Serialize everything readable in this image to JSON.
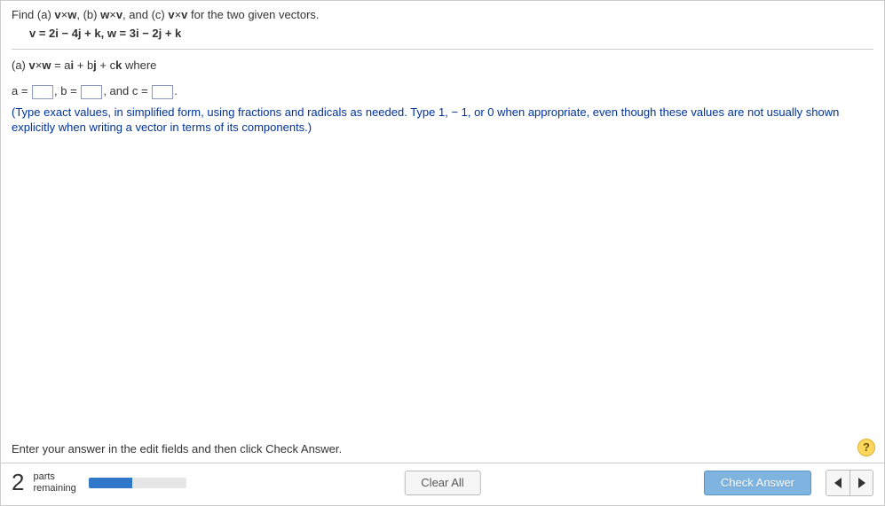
{
  "question": {
    "intro_prefix": "Find (a) ",
    "cross1_left": "v",
    "times": "×",
    "cross1_right": "w",
    "sep1": ",  (b) ",
    "cross2_left": "w",
    "cross2_right": "v",
    "sep2": ",  and (c) ",
    "cross3_left": "v",
    "cross3_right": "v",
    "intro_suffix": " for the two given vectors.",
    "vectors_line": "v = 2i − 4j + k,   w = 3i − 2j + k"
  },
  "part_a": {
    "label": "(a)  ",
    "expr_left": "v",
    "times": "×",
    "expr_right": "w",
    "equals": " = a",
    "i": "i",
    "plus1": " + b",
    "j": "j",
    "plus2": " + c",
    "k": "k",
    "suffix": " where"
  },
  "answers": {
    "a_label": "a = ",
    "comma1": ",    ",
    "b_label": "b = ",
    "comma2": ",    and ",
    "c_label": "c = ",
    "period": "."
  },
  "hint": "(Type exact values, in simplified form, using fractions and radicals as needed.  Type 1,  − 1, or 0 when appropriate, even though these values are not usually shown explicitly when writing a vector in terms of its components.)",
  "footer": {
    "instruction": "Enter your answer in the edit fields and then click Check Answer.",
    "help": "?",
    "parts_count": "2",
    "parts_label1": "parts",
    "parts_label2": "remaining",
    "clear_all": "Clear All",
    "check_answer": "Check Answer"
  }
}
